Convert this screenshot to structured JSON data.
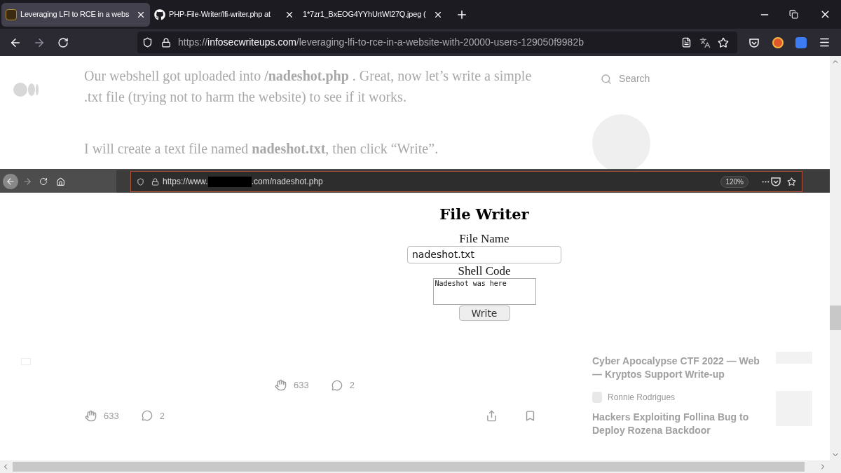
{
  "tabs": [
    {
      "title": "Leveraging LFI to RCE in a webs",
      "selected": true
    },
    {
      "title": "PHP-File-Writer/lfi-writer.php at",
      "selected": false
    },
    {
      "title": "1*7zr1_BxEOG4YYhUrtWI27Q.jpeg (",
      "selected": false
    }
  ],
  "address_bar": {
    "scheme": "https://",
    "domain": "infosecwriteups.com",
    "path": "/leveraging-lfi-to-rce-in-a-website-with-20000-users-129050f9982b"
  },
  "article": {
    "paragraphs": [
      "Our webshell got uploaded into **/nadeshot.php** . Great, now let’s write a simple .txt file (trying not to harm the website) to see if it works.",
      "I will create a text file named **nadeshot.txt**, then click “Write”."
    ],
    "search_placeholder": "Search"
  },
  "screenshot": {
    "url_prefix": "https://www.",
    "url_suffix": ".com/nadeshot.php",
    "zoom": "120%",
    "form": {
      "title": "File Writer",
      "file_name_label": "File Name",
      "file_name_value": "nadeshot.txt",
      "shell_code_label": "Shell Code",
      "shell_code_value": "Nadeshot was here",
      "button": "Write"
    }
  },
  "responses": {
    "claps": "633",
    "comments": "2",
    "footer_claps": "633",
    "footer_comments": "2"
  },
  "recommended": [
    {
      "title": "Cyber Apocalypse CTF 2022 — Web — Kryptos Support Write-up"
    },
    {
      "author": "Ronnie Rodrigues",
      "title": "Hackers Exploiting Follina Bug to Deploy Rozena Backdoor"
    }
  ]
}
